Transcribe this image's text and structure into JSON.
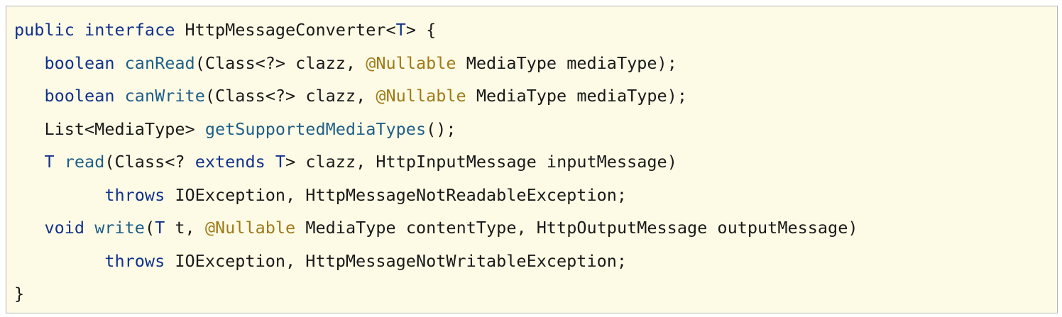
{
  "colors": {
    "background": "#fdfbe6",
    "border": "#b4b4b4",
    "keyword": "#11328a",
    "method": "#1f5f88",
    "annotation": "#a07a19",
    "text": "#1a1a1a"
  },
  "code": {
    "lines": [
      {
        "tokens": [
          {
            "t": "kw",
            "v": "public"
          },
          {
            "t": "tx",
            "v": " "
          },
          {
            "t": "kw",
            "v": "interface"
          },
          {
            "t": "tx",
            "v": " HttpMessageConverter<"
          },
          {
            "t": "ty",
            "v": "T"
          },
          {
            "t": "tx",
            "v": "> {"
          }
        ]
      },
      {
        "tokens": [
          {
            "t": "tx",
            "v": "   "
          },
          {
            "t": "kw",
            "v": "boolean"
          },
          {
            "t": "tx",
            "v": " "
          },
          {
            "t": "fn",
            "v": "canRead"
          },
          {
            "t": "tx",
            "v": "(Class<?> clazz, "
          },
          {
            "t": "an",
            "v": "@Nullable"
          },
          {
            "t": "tx",
            "v": " MediaType mediaType);"
          }
        ]
      },
      {
        "tokens": [
          {
            "t": "tx",
            "v": "   "
          },
          {
            "t": "kw",
            "v": "boolean"
          },
          {
            "t": "tx",
            "v": " "
          },
          {
            "t": "fn",
            "v": "canWrite"
          },
          {
            "t": "tx",
            "v": "(Class<?> clazz, "
          },
          {
            "t": "an",
            "v": "@Nullable"
          },
          {
            "t": "tx",
            "v": " MediaType mediaType);"
          }
        ]
      },
      {
        "tokens": [
          {
            "t": "tx",
            "v": "   List<MediaType> "
          },
          {
            "t": "fn",
            "v": "getSupportedMediaTypes"
          },
          {
            "t": "tx",
            "v": "();"
          }
        ]
      },
      {
        "tokens": [
          {
            "t": "tx",
            "v": "   "
          },
          {
            "t": "ty",
            "v": "T"
          },
          {
            "t": "tx",
            "v": " "
          },
          {
            "t": "fn",
            "v": "read"
          },
          {
            "t": "tx",
            "v": "(Class<? "
          },
          {
            "t": "kw",
            "v": "extends"
          },
          {
            "t": "tx",
            "v": " "
          },
          {
            "t": "ty",
            "v": "T"
          },
          {
            "t": "tx",
            "v": "> clazz, HttpInputMessage inputMessage)"
          }
        ]
      },
      {
        "tokens": [
          {
            "t": "tx",
            "v": "         "
          },
          {
            "t": "kw",
            "v": "throws"
          },
          {
            "t": "tx",
            "v": " IOException, HttpMessageNotReadableException;"
          }
        ]
      },
      {
        "tokens": [
          {
            "t": "tx",
            "v": "   "
          },
          {
            "t": "kw",
            "v": "void"
          },
          {
            "t": "tx",
            "v": " "
          },
          {
            "t": "fn",
            "v": "write"
          },
          {
            "t": "tx",
            "v": "("
          },
          {
            "t": "ty",
            "v": "T"
          },
          {
            "t": "tx",
            "v": " t, "
          },
          {
            "t": "an",
            "v": "@Nullable"
          },
          {
            "t": "tx",
            "v": " MediaType contentType, HttpOutputMessage outputMessage)"
          }
        ]
      },
      {
        "tokens": [
          {
            "t": "tx",
            "v": "         "
          },
          {
            "t": "kw",
            "v": "throws"
          },
          {
            "t": "tx",
            "v": " IOException, HttpMessageNotWritableException;"
          }
        ]
      },
      {
        "tokens": [
          {
            "t": "tx",
            "v": "}"
          }
        ]
      }
    ]
  }
}
